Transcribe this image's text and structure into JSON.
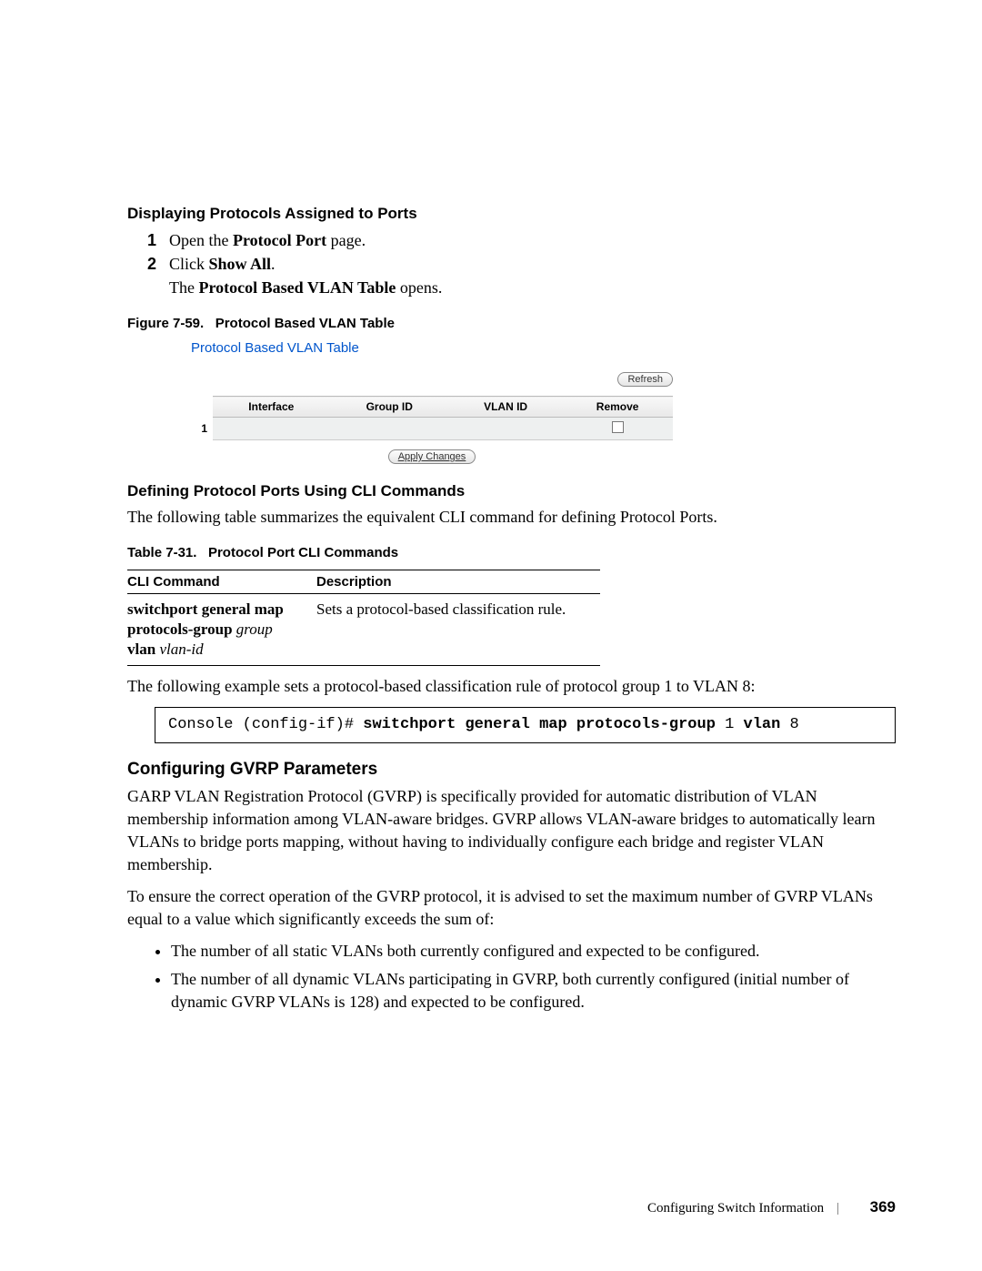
{
  "section1": {
    "heading": "Displaying Protocols Assigned to Ports",
    "steps": [
      {
        "num": "1",
        "pre": "Open the ",
        "bold": "Protocol Port",
        "post": " page."
      },
      {
        "num": "2",
        "pre": "Click ",
        "bold": "Show All",
        "post": ".",
        "extra_pre": "The ",
        "extra_bold": "Protocol Based VLAN Table",
        "extra_post": " opens."
      }
    ]
  },
  "figure": {
    "caption_prefix": "Figure 7-59.",
    "caption_text": "Protocol Based VLAN Table",
    "title": "Protocol Based VLAN Table",
    "refresh": "Refresh",
    "headers": [
      "",
      "Interface",
      "Group ID",
      "VLAN ID",
      "Remove"
    ],
    "row1_idx": "1",
    "apply": "Apply Changes"
  },
  "section2": {
    "heading": "Defining Protocol Ports Using CLI Commands",
    "intro": "The following table summarizes the equivalent CLI command for defining Protocol Ports."
  },
  "table": {
    "caption_prefix": "Table 7-31.",
    "caption_text": "Protocol Port CLI Commands",
    "head_cmd": "CLI Command",
    "head_desc": "Description",
    "row": {
      "cmd_b1": "switchport general map",
      "cmd_b2": "protocols-group",
      "cmd_i2": " group",
      "cmd_b3": "vlan",
      "cmd_i3": " vlan-id",
      "desc": "Sets a protocol-based classification rule."
    }
  },
  "example": {
    "intro": "The following example sets a protocol-based classification rule of protocol group 1 to VLAN 8:",
    "line1_pre": "Console (config-if)# ",
    "line1_b": "switchport general map protocols-group",
    "line1_post": " 1 ",
    "line2_b": "vlan",
    "line2_post": " 8"
  },
  "gvrp": {
    "heading": "Configuring GVRP Parameters",
    "p1": "GARP VLAN Registration Protocol (GVRP) is specifically provided for automatic distribution of VLAN membership information among VLAN-aware bridges. GVRP allows VLAN-aware bridges to automatically learn VLANs to bridge ports mapping, without having to individually configure each bridge and register VLAN membership.",
    "p2": "To ensure the correct operation of the GVRP protocol, it is advised to set the maximum number of GVRP VLANs equal to a value which significantly exceeds the sum of:",
    "bullets": [
      "The number of all static VLANs both currently configured and expected to be configured.",
      "The number of all dynamic VLANs participating in GVRP, both currently configured (initial number of dynamic GVRP VLANs is 128) and expected to be configured."
    ]
  },
  "footer": {
    "chapter": "Configuring Switch Information",
    "page": "369"
  }
}
